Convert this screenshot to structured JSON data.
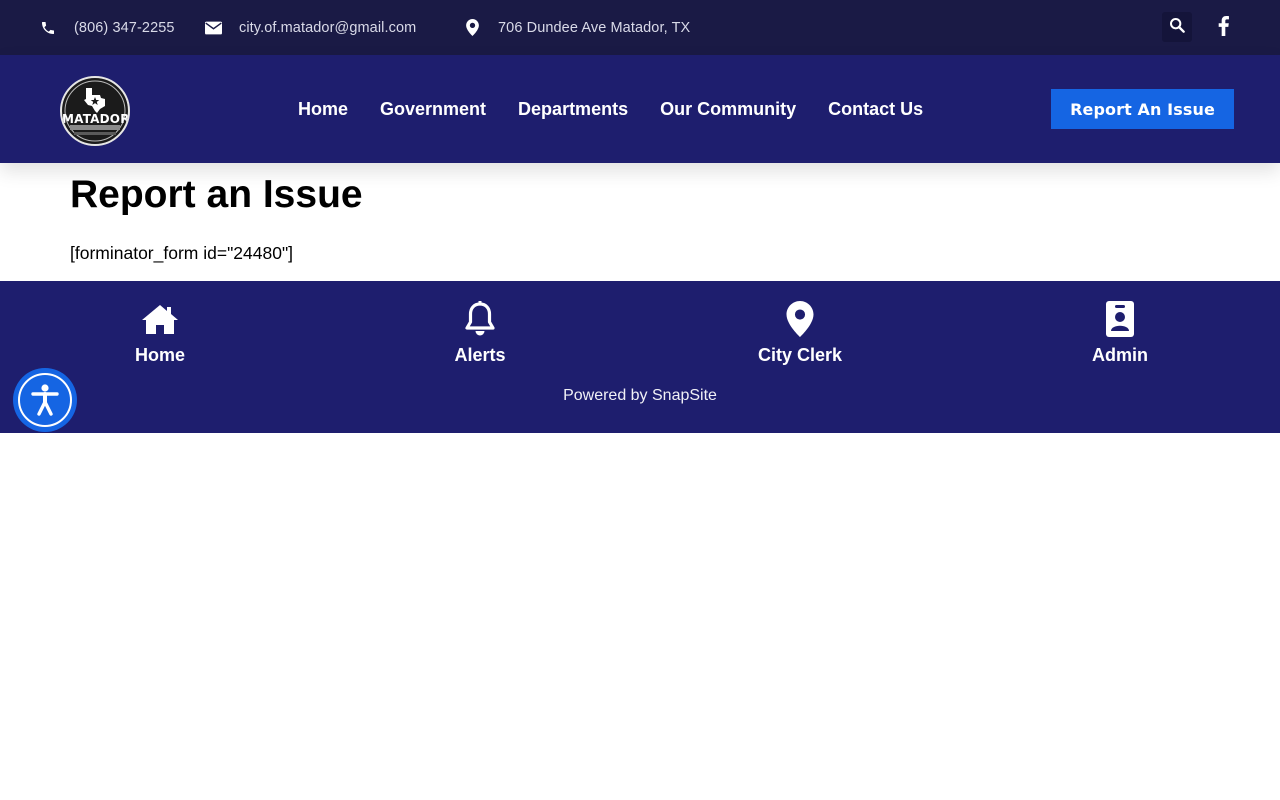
{
  "topbar": {
    "phone": "(806) 347-2255",
    "email": "city.of.matador@gmail.com",
    "address": "706 Dundee Ave Matador, TX",
    "icons": {
      "phone": "phone-icon",
      "email": "envelope-icon",
      "address": "map-pin-icon",
      "search": "search-icon",
      "social": "facebook-icon"
    }
  },
  "header": {
    "logo_text": "MATADOR",
    "nav": [
      "Home",
      "Government",
      "Departments",
      "Our Community",
      "Contact Us"
    ],
    "cta_label": "Report An Issue"
  },
  "main": {
    "title": "Report an Issue",
    "shortcode": "[forminator_form id=\"24480\"]"
  },
  "footer": {
    "items": [
      {
        "label": "Home",
        "icon": "home-icon"
      },
      {
        "label": "Alerts",
        "icon": "bell-icon"
      },
      {
        "label": "City Clerk",
        "icon": "map-marker-icon"
      },
      {
        "label": "Admin",
        "icon": "id-badge-icon"
      }
    ],
    "powered_by": "Powered by SnapSite"
  },
  "colors": {
    "topbar_bg": "#1a1a45",
    "header_bg": "#1e1e6e",
    "accent": "#1565e3"
  }
}
